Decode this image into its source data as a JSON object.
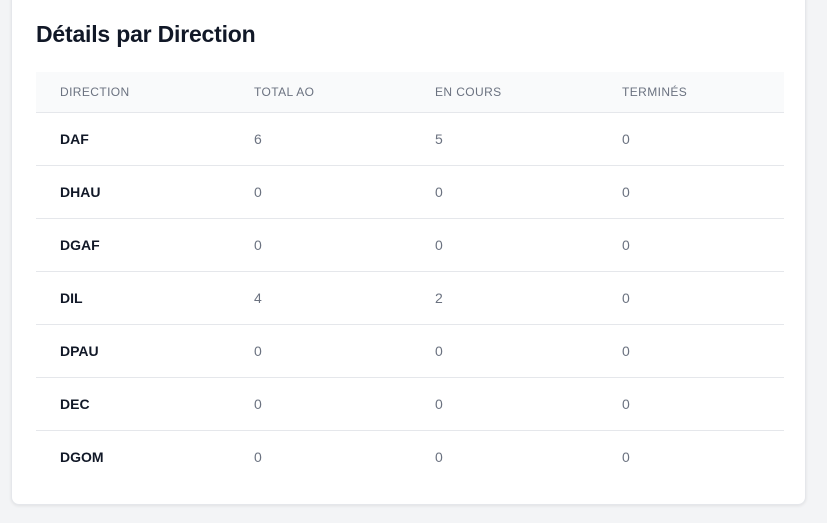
{
  "card": {
    "title": "Détails par Direction"
  },
  "table": {
    "headers": [
      "DIRECTION",
      "TOTAL AO",
      "EN COURS",
      "TERMINÉS"
    ],
    "rows": [
      [
        "DAF",
        "6",
        "5",
        "0"
      ],
      [
        "DHAU",
        "0",
        "0",
        "0"
      ],
      [
        "DGAF",
        "0",
        "0",
        "0"
      ],
      [
        "DIL",
        "4",
        "2",
        "0"
      ],
      [
        "DPAU",
        "0",
        "0",
        "0"
      ],
      [
        "DEC",
        "0",
        "0",
        "0"
      ],
      [
        "DGOM",
        "0",
        "0",
        "0"
      ]
    ]
  }
}
